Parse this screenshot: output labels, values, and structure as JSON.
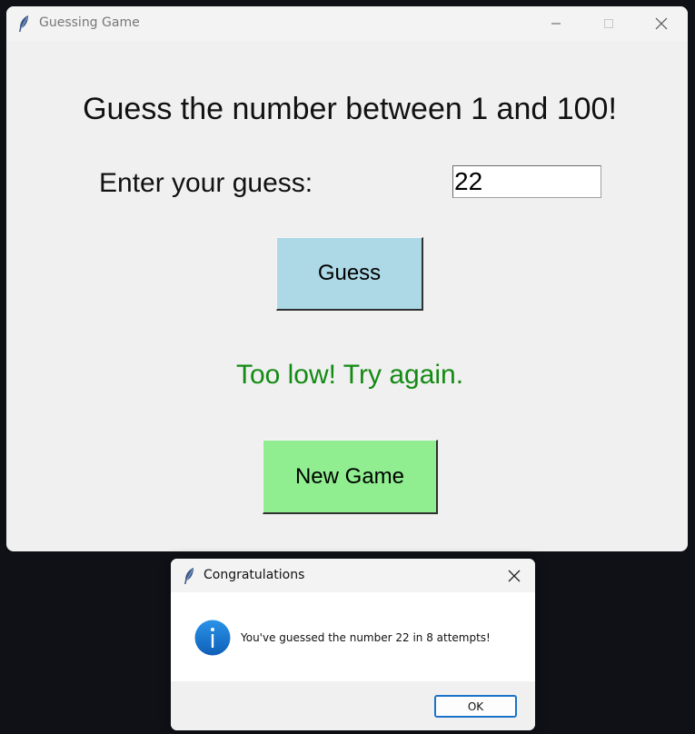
{
  "main_window": {
    "title": "Guessing Game",
    "headline": "Guess the number between 1 and 100!",
    "guess_label": "Enter your guess:",
    "guess_value": "22",
    "guess_button_label": "Guess",
    "feedback": "Too low! Try again.",
    "new_game_label": "New Game"
  },
  "dialog": {
    "title": "Congratulations",
    "message": "You've guessed the number 22 in 8 attempts!",
    "ok_label": "OK",
    "icon": "info-icon"
  },
  "colors": {
    "guess_button_bg": "#add8e6",
    "new_game_button_bg": "#90ee90",
    "feedback_text": "#138a13",
    "window_bg": "#f0f0f0",
    "desktop_bg": "#0f1117",
    "ok_button_border": "#1a73c8",
    "info_icon": "#1877d6"
  },
  "icons": {
    "app": "feather-icon",
    "minimize": "minimize-icon",
    "maximize": "maximize-icon",
    "close": "close-icon"
  }
}
